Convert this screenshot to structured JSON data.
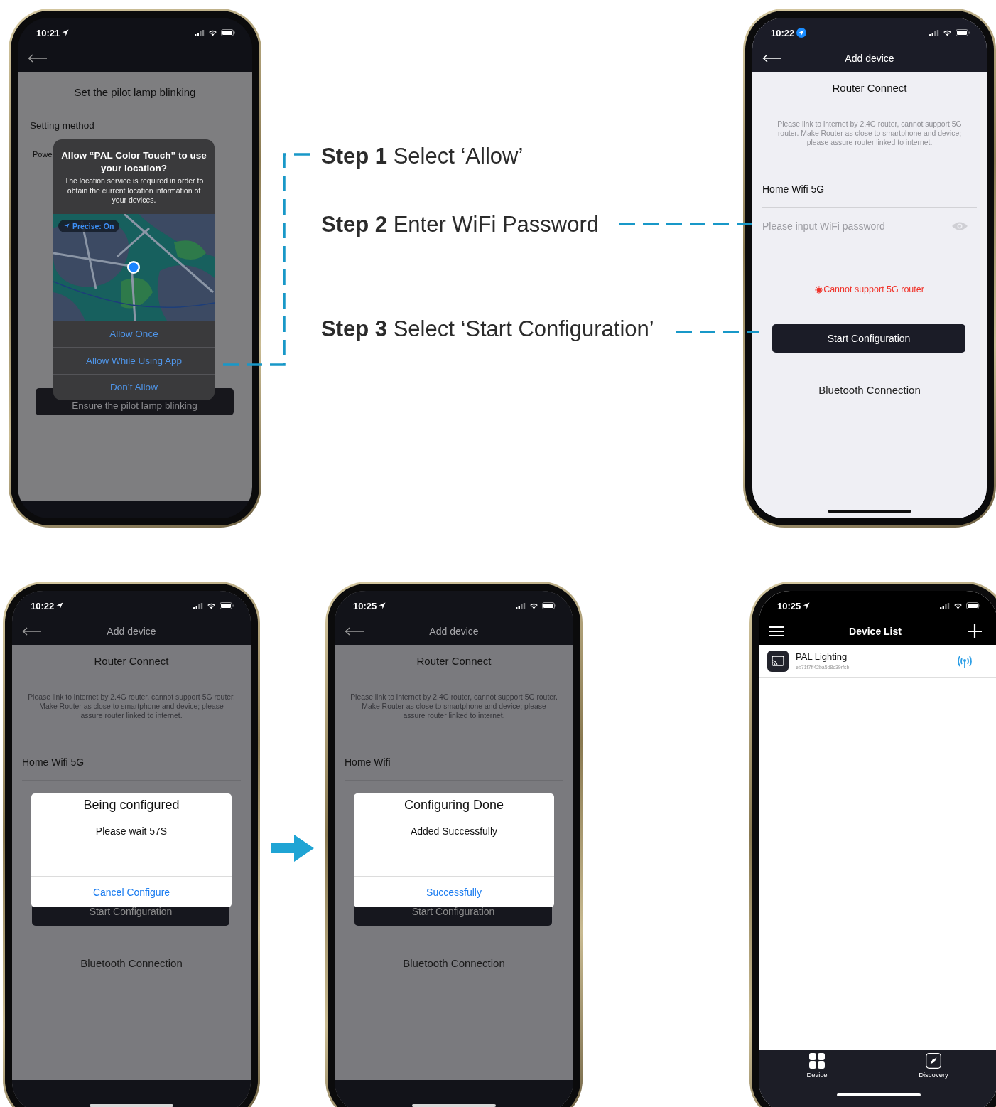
{
  "steps": [
    {
      "label": "Step 1",
      "text": "Select ‘Allow’"
    },
    {
      "label": "Step 2",
      "text": "Enter WiFi Password"
    },
    {
      "label": "Step 3",
      "text": "Select ‘Start Configuration’"
    }
  ],
  "phones": [
    {
      "kind": "permission",
      "time": "10:21",
      "location_highlight": false,
      "dimmed": true,
      "title": "Set the pilot lamp blinking",
      "section": "Setting method",
      "cut_label": "Powe",
      "button": "Ensure the pilot lamp blinking",
      "alert": {
        "title": "Allow “PAL Color Touch” to use your location?",
        "message": "The location service is required in order to obtain the current location information of your devices.",
        "badge": "Precise: On",
        "actions": [
          "Allow Once",
          "Allow While Using App",
          "Don’t Allow"
        ]
      }
    },
    {
      "kind": "router",
      "time": "10:22",
      "location_highlight": true,
      "dimmed": false,
      "nav_title": "Add device",
      "heading": "Router Connect",
      "hint": "Please link to internet by 2.4G router, cannot support 5G router. Make Router as close to smartphone and device; please assure router linked to internet.",
      "wifi": "Home Wifi 5G",
      "password_placeholder": "Please input WiFi password",
      "warning": "Cannot support 5G router",
      "button": "Start Configuration",
      "link": "Bluetooth Connection"
    },
    {
      "kind": "router",
      "time": "10:22",
      "location_highlight": false,
      "dimmed": true,
      "nav_title": "Add device",
      "heading": "Router Connect",
      "hint": "Please link to internet by 2.4G router, cannot support 5G router. Make Router as close to smartphone and device; please assure router linked to internet.",
      "wifi": "Home Wifi 5G",
      "button": "Start Configuration",
      "link": "Bluetooth Connection",
      "dialog": {
        "title": "Being configured",
        "message": "Please wait 57S",
        "action": "Cancel Configure"
      }
    },
    {
      "kind": "router",
      "time": "10:25",
      "location_highlight": false,
      "dimmed": true,
      "nav_title": "Add device",
      "heading": "Router Connect",
      "hint": "Please link to internet by 2.4G router, cannot support 5G router. Make Router as close to smartphone and device; please assure router linked to internet.",
      "wifi": "Home Wifi",
      "button": "Start Configuration",
      "link": "Bluetooth Connection",
      "dialog": {
        "title": "Configuring Done",
        "message": "Added Successfully",
        "action": "Successfully"
      }
    },
    {
      "kind": "device_list",
      "time": "10:25",
      "location_highlight": false,
      "nav_title": "Device List",
      "devices": [
        {
          "name": "PAL Lighting",
          "id": "eb71f7ff42ba5d8c39rfsb"
        }
      ],
      "tabs": [
        "Device",
        "Discovery"
      ]
    }
  ]
}
